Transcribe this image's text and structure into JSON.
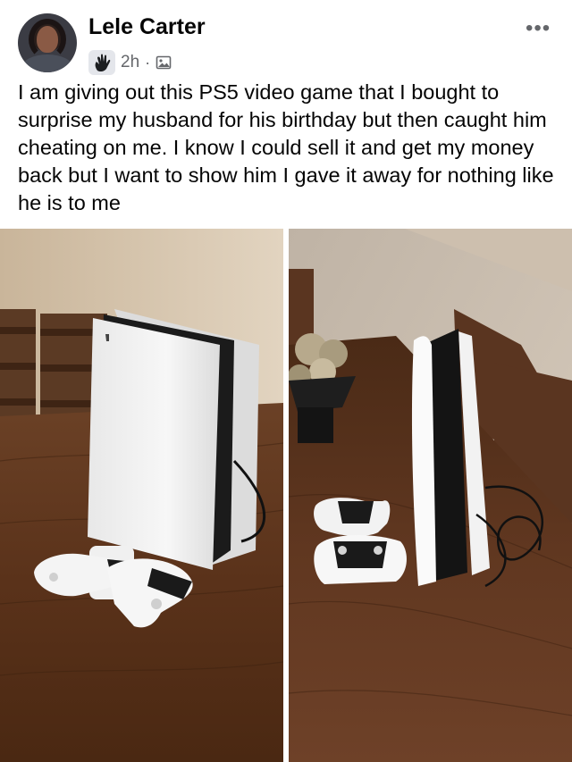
{
  "post": {
    "author": "Lele Carter",
    "time": "2h",
    "separator": "·",
    "text": "I am giving out this PS5 video game that I bought to surprise my husband for his birthday but then caught him cheating on me. I know I could sell it and get my money back but I want to show him I gave it away for nothing like he is to me"
  },
  "icons": {
    "audience": "wave-icon",
    "privacy": "photo-icon",
    "more": "more-options-icon"
  },
  "header": {
    "more_label": "•••"
  },
  "colors": {
    "text": "#050505",
    "secondary": "#65676b",
    "chip": "#e4e6eb"
  }
}
